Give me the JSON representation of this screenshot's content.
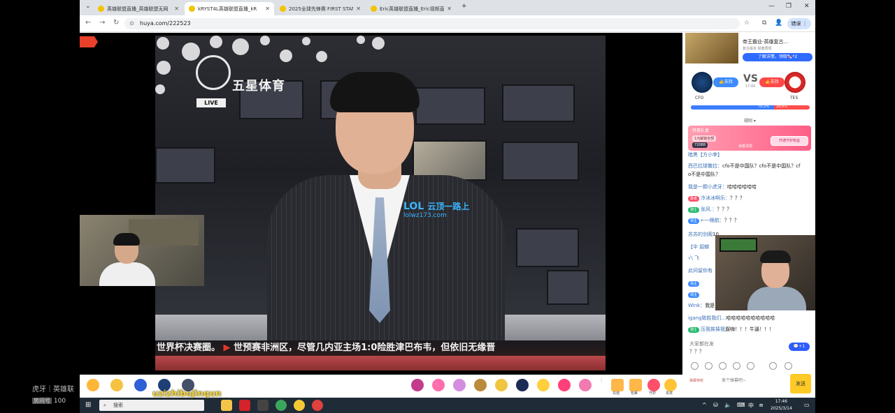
{
  "browser": {
    "tabs": [
      {
        "title": "英雄联盟直播_英雄联盟无网"
      },
      {
        "title": "kRYST4L英雄联盟直播_kR"
      },
      {
        "title": "2025全球先锋赛 FIRST STAND"
      },
      {
        "title": "Eric英雄联盟直播_Eric视频直"
      }
    ],
    "new_tab": "+",
    "url": "huya.com/222523",
    "profile_label": "错误"
  },
  "video": {
    "channel_logo_text": "五星体育",
    "live_badge": "LIVE",
    "watermark_lol": "LOL",
    "watermark_cn": "云顶一路上",
    "watermark_url": "lolwz173.com",
    "ticker_a": "世界杯决赛圈。",
    "ticker_b": "世预赛非洲区，尽管几内亚主场1:0险胜津巴布韦，但依旧无缘晋",
    "room_id": "虎牙直播 222523"
  },
  "right_panel": {
    "ad": {
      "title": "帝王霸业-英雄复古...",
      "subtitle": "复古版本 经典再现",
      "button": "了解详情，领取🍬*2"
    },
    "match": {
      "team1": "CFO",
      "team2": "TES",
      "vs": "VS",
      "time": "17:00",
      "support1": "支持",
      "support2": "支持",
      "pct1": "70.2%",
      "pct2": "29.8%",
      "pct1_value": 70.2,
      "rules": "规则 ▾"
    },
    "promo": {
      "title": "特惠礼盒",
      "a": "1元解锁全部",
      "b": "72088",
      "c": "余额详情",
      "button": "开通守护权益"
    },
    "chat": [
      {
        "user": "暗黑【方小李】",
        "text": ""
      },
      {
        "user": "西巴拉球撒拉：",
        "text": "cfo不是中国队？cfo不是中国队？cf"
      },
      {
        "user": "",
        "text": "o不是中国队？"
      },
      {
        "user": "我是一颗小虎牙：",
        "text": "哈哈哈哈哈哈"
      },
      {
        "user": "冷冰冰啊乐：",
        "text": "？？？",
        "lvl": "勇者",
        "lvlc": "red"
      },
      {
        "user": "张风.：",
        "text": "？？？",
        "lvl": "骑士",
        "lvlc": "green"
      },
      {
        "user": "←一眼航：",
        "text": "？？？",
        "lvl": "领主",
        "lvlc": "blue"
      },
      {
        "user": "苏苏的剑阁",
        "text": "10"
      },
      {
        "user": "【伞 貂蝉",
        "text": ""
      },
      {
        "user": "√\\ 飞",
        "text": ""
      },
      {
        "user": "此间留你有",
        "text": ""
      },
      {
        "user": "",
        "text": "",
        "lvl": "领主",
        "lvlc": "blue"
      },
      {
        "user": "",
        "text": "",
        "lvl": "领主",
        "lvlc": "blue"
      },
      {
        "user": "Wink：",
        "text": "我是"
      },
      {
        "user": "igang致胜我们...",
        "text": "哈哈哈哈哈哈哈哈哈哈"
      },
      {
        "user": "压我挨揍我",
        "text": "遛嗨！！！牛逼！！！",
        "lvl": "骑士",
        "lvlc": "green"
      }
    ],
    "chat_placeholder": "大家都在发",
    "chat_tail": "？？？",
    "new_msgs": "💬+1",
    "vip": "弹幕特权",
    "input_placeholder": "发个弹幕吧~",
    "send": "发送"
  },
  "giftbar": {
    "labels": [
      "充值",
      "包裹",
      "守护",
      "贵宾"
    ]
  },
  "taskbar": {
    "search": "搜索",
    "time": "17:46",
    "date": "2025/3/14",
    "lang": "中"
  },
  "overlay": {
    "title": "虎牙｜英雄联",
    "room_label": "房间号",
    "room_no": "100",
    "username": "uzizhibojinqun"
  },
  "colors": {
    "huya_yellow": "#ffc926",
    "blue_support": "#3d8bff",
    "red_support": "#ff4848"
  }
}
